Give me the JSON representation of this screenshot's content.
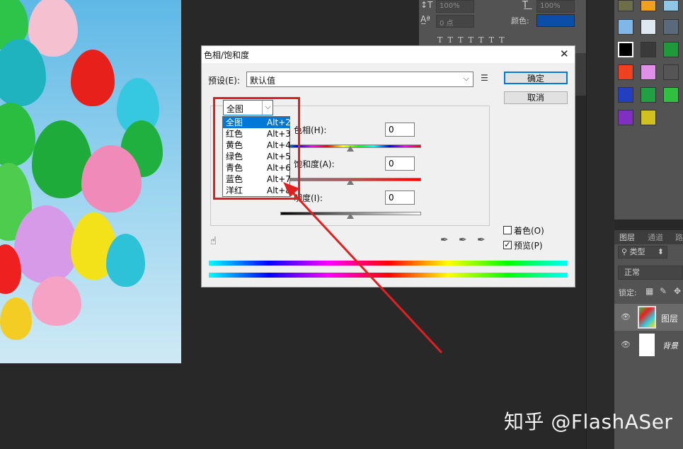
{
  "options_bar": {
    "size_value": "100%",
    "tracking_value": "0 点",
    "scale_value": "100%",
    "color_label": "颜色:",
    "color_swatch": "#0a4ea8"
  },
  "dialog": {
    "title": "色相/饱和度",
    "preset_label": "预设(E):",
    "preset_value": "默认值",
    "ok_button": "确定",
    "cancel_button": "取消",
    "channel_value": "全图",
    "hue_label": "色相(H):",
    "hue_value": "0",
    "saturation_label": "饱和度(A):",
    "saturation_value": "0",
    "lightness_label": "明度(I):",
    "lightness_value": "0",
    "colorize_label": "着色(O)",
    "colorize_checked": false,
    "preview_label": "预览(P)",
    "preview_checked": true
  },
  "channel_dropdown": {
    "items": [
      {
        "label": "全图",
        "shortcut": "Alt+2",
        "selected": true
      },
      {
        "label": "红色",
        "shortcut": "Alt+3"
      },
      {
        "label": "黄色",
        "shortcut": "Alt+4"
      },
      {
        "label": "绿色",
        "shortcut": "Alt+5"
      },
      {
        "label": "青色",
        "shortcut": "Alt+6"
      },
      {
        "label": "蓝色",
        "shortcut": "Alt+7"
      },
      {
        "label": "洋红",
        "shortcut": "Alt+8"
      }
    ]
  },
  "layers_panel": {
    "tab_layers": "图层",
    "tab_channels": "通道",
    "tab_paths": "路",
    "filter_kind": "类型",
    "blend_mode": "正常",
    "lock_label": "锁定:",
    "layers": [
      {
        "name": "图层"
      },
      {
        "name": "背景"
      }
    ]
  },
  "watermark": "知乎 @FlashASer",
  "colors": {
    "highlight": "#0078d7",
    "annotation_red": "#e02020"
  }
}
